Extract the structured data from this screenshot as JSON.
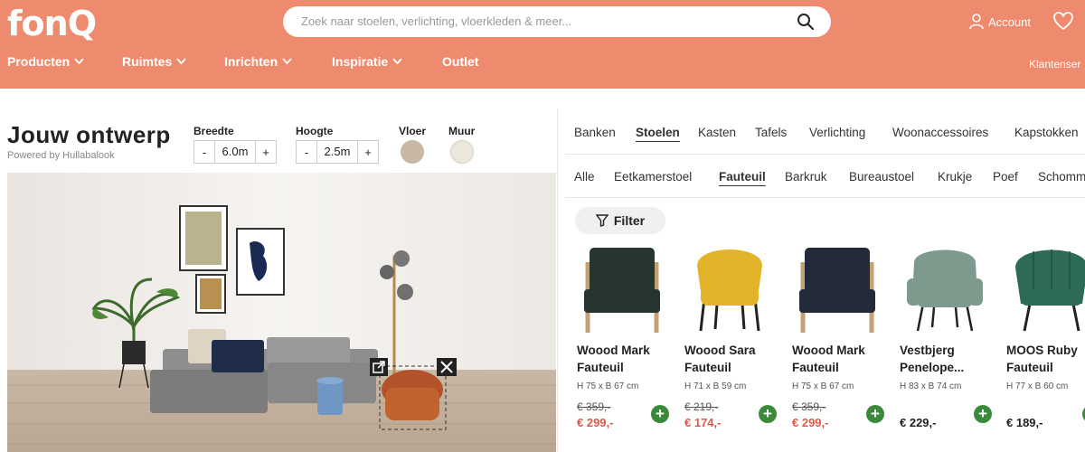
{
  "header": {
    "logo": "fonQ",
    "search_placeholder": "Zoek naar stoelen, verlichting, vloerkleden & meer...",
    "account_label": "Account",
    "nav": [
      {
        "label": "Producten"
      },
      {
        "label": "Ruimtes"
      },
      {
        "label": "Inrichten"
      },
      {
        "label": "Inspiratie"
      },
      {
        "label": "Outlet"
      }
    ],
    "klantenservice": "Klantenser"
  },
  "designer": {
    "title": "Jouw ontwerp",
    "powered": "Powered by Hullabalook",
    "breedte": {
      "label": "Breedte",
      "value": "6.0m",
      "minus": "-",
      "plus": "+"
    },
    "hoogte": {
      "label": "Hoogte",
      "value": "2.5m",
      "minus": "-",
      "plus": "+"
    },
    "vloer": {
      "label": "Vloer",
      "color": "#c9b7a6"
    },
    "muur": {
      "label": "Muur",
      "color": "#ece6dc"
    }
  },
  "categories": [
    "Banken",
    "Stoelen",
    "Kasten",
    "Tafels",
    "Verlichting",
    "Woonaccessoires",
    "Kapstokken"
  ],
  "active_category": "Stoelen",
  "subcategories": [
    "Alle",
    "Eetkamerstoel",
    "Fauteuil",
    "Barkruk",
    "Bureaustoel",
    "Krukje",
    "Poef",
    "Schommelstoel"
  ],
  "active_subcategory": "Fauteuil",
  "filter_label": "Filter",
  "products": [
    {
      "name": "Woood Mark Fauteuil",
      "dims": "H 75 x B 67 cm",
      "old_price": "€ 359,-",
      "price": "€ 299,-",
      "color": "#26352e"
    },
    {
      "name": "Woood Sara Fauteuil",
      "dims": "H 71 x B 59 cm",
      "old_price": "€ 219,-",
      "price": "€ 174,-",
      "color": "#e3b42a"
    },
    {
      "name": "Woood Mark Fauteuil",
      "dims": "H 75 x B 67 cm",
      "old_price": "€ 359,-",
      "price": "€ 299,-",
      "color": "#232a3a"
    },
    {
      "name": "Vestbjerg Penelope...",
      "dims": "H 83 x B 74 cm",
      "old_price": "",
      "price": "€ 229,-",
      "color": "#7d9a8c"
    },
    {
      "name": "MOOS Ruby Fauteuil",
      "dims": "H 77 x B 60 cm",
      "old_price": "",
      "price": "€ 189,-",
      "color": "#2e6b56"
    }
  ],
  "colors": {
    "brand": "#ee8a6e",
    "sale": "#e0584a",
    "add": "#3b8a3b"
  }
}
